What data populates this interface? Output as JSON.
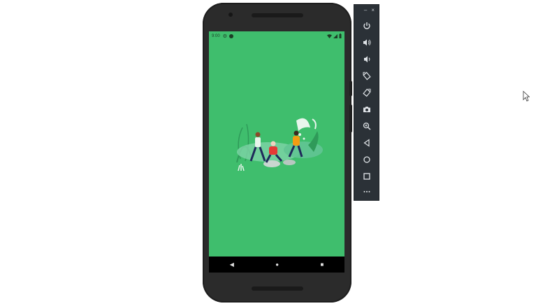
{
  "status_bar": {
    "time": "9:00",
    "settings_icon": "gear-icon",
    "notification_icon": "android-icon",
    "wifi_icon": "wifi-icon",
    "signal_icon": "signal-icon",
    "battery_icon": "battery-icon"
  },
  "screen": {
    "background_color": "#3fbe6d",
    "illustration": "people-in-park-illustration"
  },
  "navbar": {
    "back_icon": "back-icon",
    "home_icon": "home-icon",
    "recents_icon": "recents-icon"
  },
  "toolbar": {
    "minimize_label": "–",
    "close_label": "×",
    "buttons": [
      {
        "name": "power",
        "icon": "power-icon"
      },
      {
        "name": "volume-up",
        "icon": "volume-up-icon"
      },
      {
        "name": "volume-down",
        "icon": "volume-down-icon"
      },
      {
        "name": "rotate-left",
        "icon": "rotate-left-icon"
      },
      {
        "name": "rotate-right",
        "icon": "rotate-right-icon"
      },
      {
        "name": "screenshot",
        "icon": "camera-icon"
      },
      {
        "name": "zoom",
        "icon": "zoom-icon"
      },
      {
        "name": "back",
        "icon": "back-icon"
      },
      {
        "name": "home",
        "icon": "home-icon"
      },
      {
        "name": "overview",
        "icon": "recents-icon"
      },
      {
        "name": "more",
        "icon": "more-icon"
      }
    ]
  },
  "colors": {
    "phone_body": "#2b2b2b",
    "toolbar_bg": "#2b3137",
    "toolbar_icon": "#dfe3e7"
  }
}
